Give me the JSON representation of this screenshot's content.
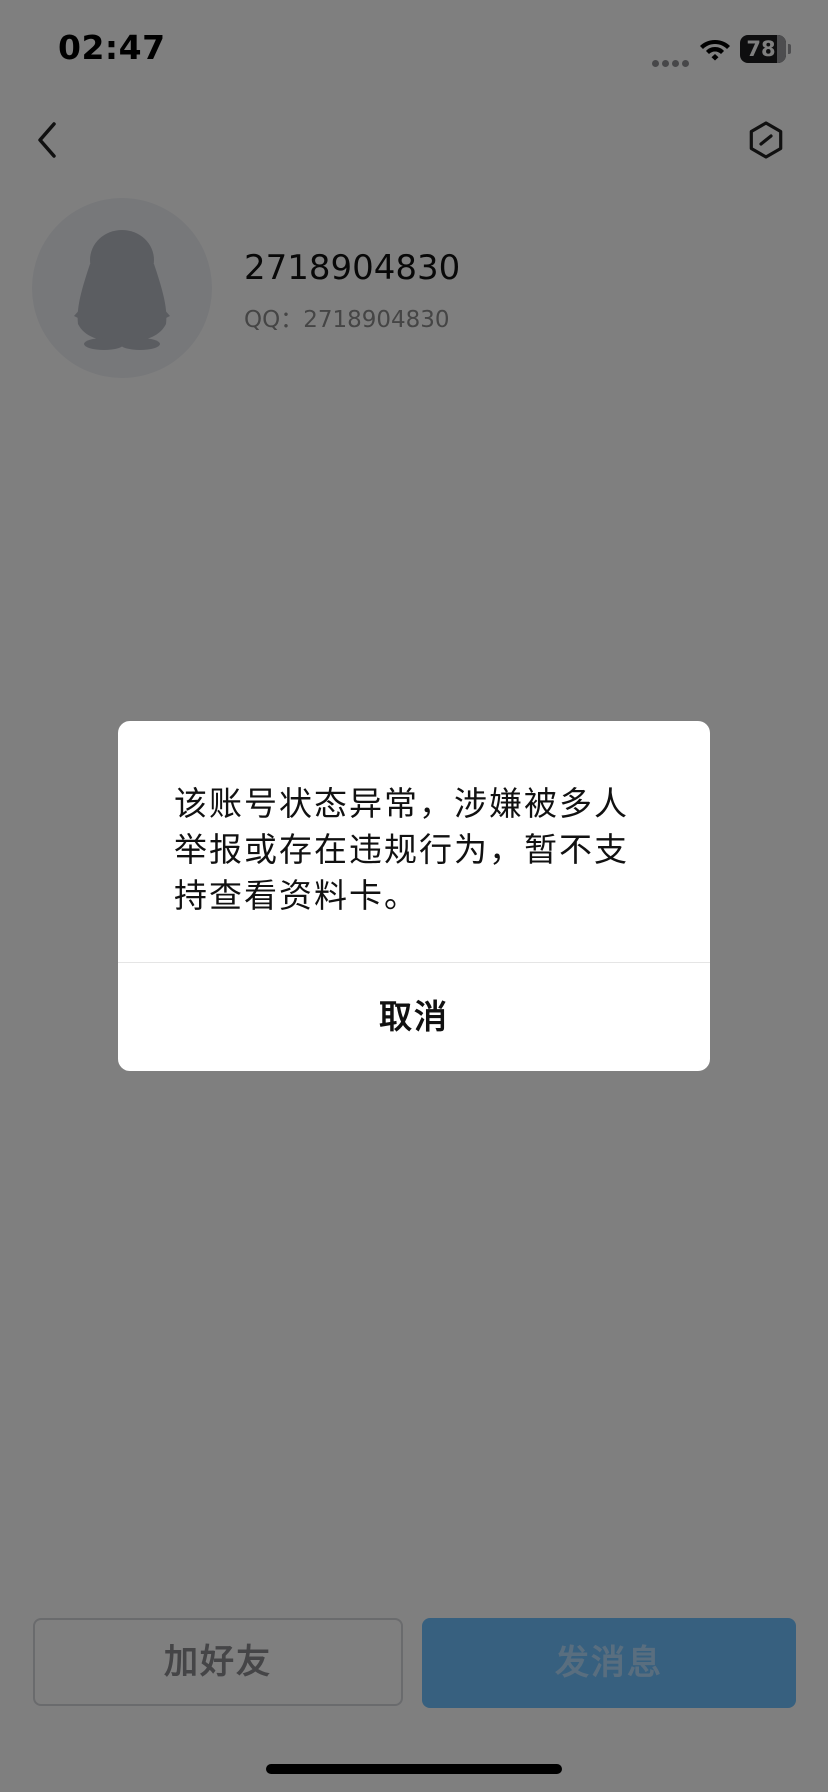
{
  "status_bar": {
    "time": "02:47",
    "battery_level": "78",
    "icons": [
      "signal-dots-icon",
      "wifi-icon",
      "battery-icon"
    ]
  },
  "nav": {
    "back_icon": "chevron-left-icon",
    "settings_icon": "hexagon-settings-icon"
  },
  "profile": {
    "avatar_icon": "penguin-avatar-icon",
    "name": "2718904830",
    "qq_line": "QQ：2718904830"
  },
  "actions": {
    "add_friend_label": "加好友",
    "send_message_label": "发消息",
    "send_message_color": "#6ec1ff"
  },
  "dialog": {
    "message": "该账号状态异常，涉嫌被多人举报或存在违规行为，暂不支持查看资料卡。",
    "cancel_label": "取消"
  },
  "colors": {
    "overlay": "rgba(0,0,0,0.5)",
    "accent": "#6ec1ff"
  }
}
